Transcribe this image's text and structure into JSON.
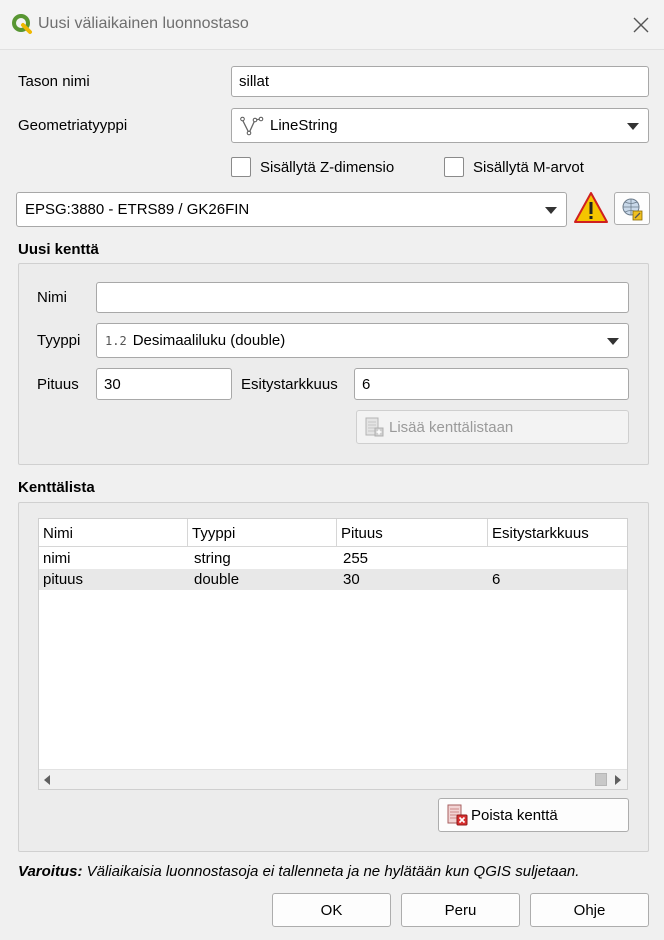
{
  "window": {
    "title": "Uusi väliaikainen luonnostaso"
  },
  "form": {
    "layer_name_label": "Tason nimi",
    "layer_name_value": "sillat",
    "geometry_type_label": "Geometriatyyppi",
    "geometry_type_value": "LineString",
    "include_z_label": "Sisällytä Z-dimensio",
    "include_m_label": "Sisällytä M-arvot",
    "crs_value": "EPSG:3880 - ETRS89 / GK26FIN"
  },
  "new_field": {
    "group_title": "Uusi kenttä",
    "name_label": "Nimi",
    "name_value": "",
    "type_label": "Tyyppi",
    "type_badge": "1.2",
    "type_value": "Desimaaliluku (double)",
    "length_label": "Pituus",
    "length_value": "30",
    "precision_label": "Esitystarkkuus",
    "precision_value": "6",
    "add_button": "Lisää kenttälistaan"
  },
  "field_list": {
    "group_title": "Kenttälista",
    "columns": [
      "Nimi",
      "Tyyppi",
      "Pituus",
      "Esitystarkkuus"
    ],
    "rows": [
      {
        "name": "nimi",
        "type": "string",
        "length": "255",
        "precision": ""
      },
      {
        "name": "pituus",
        "type": "double",
        "length": "30",
        "precision": "6"
      }
    ],
    "remove_button": "Poista kenttä"
  },
  "warning": {
    "bold": "Varoitus:",
    "text": " Väliaikaisia luonnostasoja ei tallenneta ja ne hylätään kun QGIS suljetaan."
  },
  "buttons": {
    "ok": "OK",
    "cancel": "Peru",
    "help": "Ohje"
  },
  "colors": {
    "qgis_green": "#589632",
    "qgis_yellow": "#f0b800",
    "warning_yellow": "#f5c400",
    "selected_row": "#e8e8e8"
  }
}
